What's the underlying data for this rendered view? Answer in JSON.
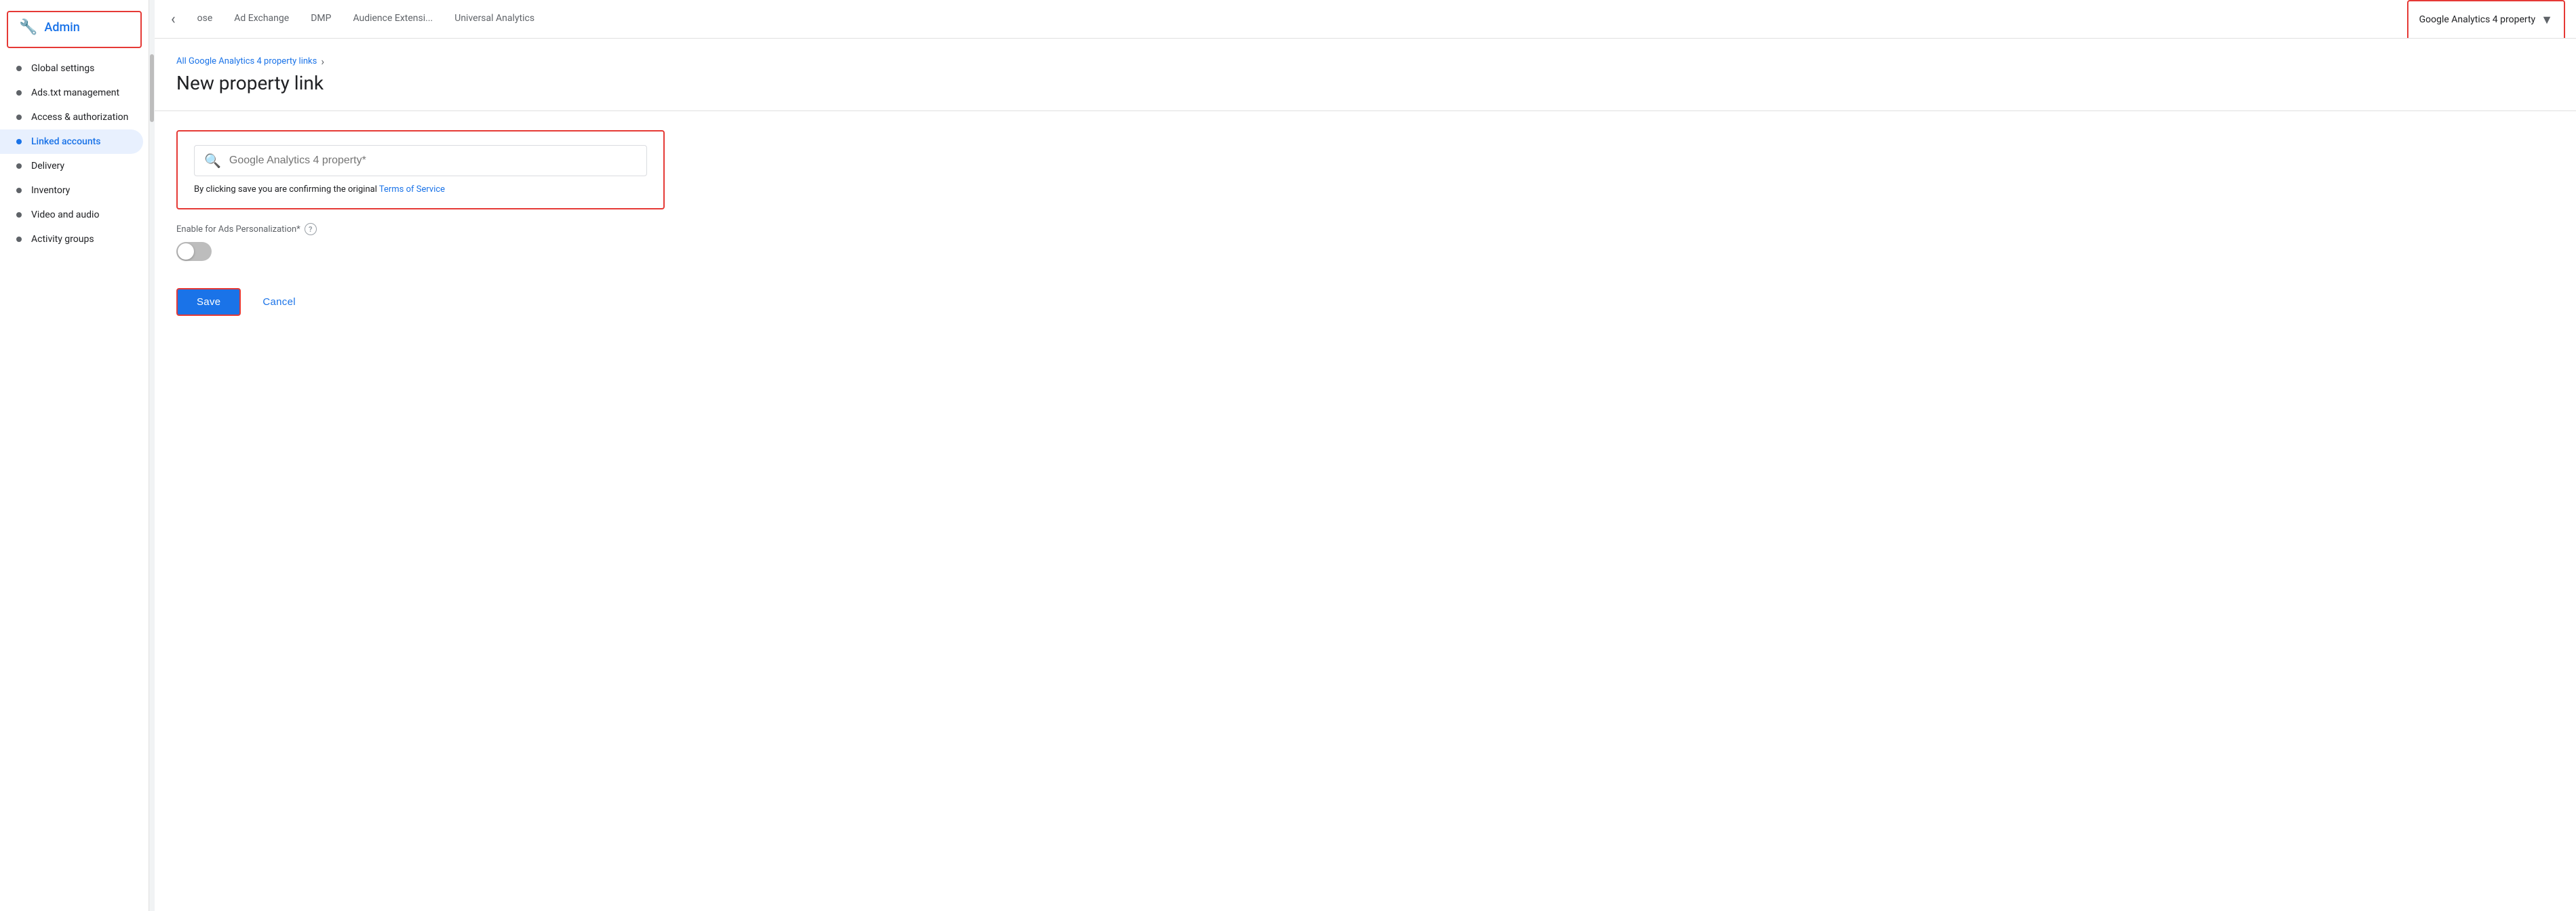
{
  "sidebar": {
    "header": {
      "title": "Admin",
      "icon": "⚙"
    },
    "items": [
      {
        "id": "global-settings",
        "label": "Global settings",
        "active": false
      },
      {
        "id": "ads-txt-management",
        "label": "Ads.txt management",
        "active": false
      },
      {
        "id": "access-authorization",
        "label": "Access & authorization",
        "active": false
      },
      {
        "id": "linked-accounts",
        "label": "Linked accounts",
        "active": true
      },
      {
        "id": "delivery",
        "label": "Delivery",
        "active": false
      },
      {
        "id": "inventory",
        "label": "Inventory",
        "active": false
      },
      {
        "id": "video-and-audio",
        "label": "Video and audio",
        "active": false
      },
      {
        "id": "activity-groups",
        "label": "Activity groups",
        "active": false
      }
    ]
  },
  "top_nav": {
    "tabs": [
      {
        "id": "ose",
        "label": "ose",
        "active": false
      },
      {
        "id": "ad-exchange",
        "label": "Ad Exchange",
        "active": false
      },
      {
        "id": "dmp",
        "label": "DMP",
        "active": false
      },
      {
        "id": "audience-extensi",
        "label": "Audience Extensi...",
        "active": false
      },
      {
        "id": "universal-analytics",
        "label": "Universal Analytics",
        "active": false
      }
    ],
    "dropdown_tab": {
      "label": "Google Analytics 4 property",
      "active": true
    }
  },
  "main": {
    "breadcrumb": {
      "link_text": "All Google Analytics 4 property links",
      "separator": "›"
    },
    "page_title": "New property link",
    "form": {
      "search_placeholder": "Google Analytics 4 property*",
      "tos_text": "By clicking save you are confirming the original ",
      "tos_link_text": "Terms of Service",
      "toggle_label": "Enable for Ads Personalization*",
      "toggle_help": "?",
      "toggle_enabled": false
    },
    "actions": {
      "save_label": "Save",
      "cancel_label": "Cancel"
    }
  }
}
